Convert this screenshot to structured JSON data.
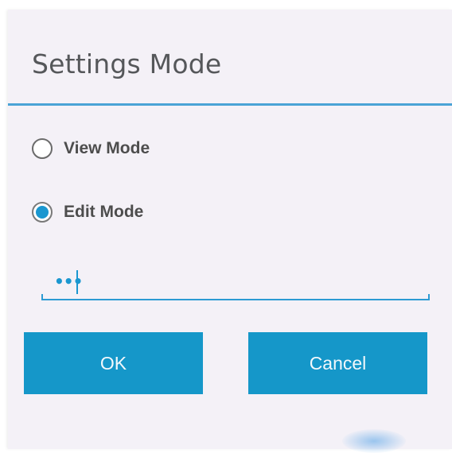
{
  "dialog": {
    "title": "Settings Mode",
    "options": [
      {
        "label": "View Mode",
        "selected": false
      },
      {
        "label": "Edit Mode",
        "selected": true
      }
    ],
    "password": {
      "value": "•••",
      "masked": true
    },
    "buttons": {
      "ok_label": "OK",
      "cancel_label": "Cancel"
    }
  },
  "colors": {
    "accent": "#1597c9",
    "divider": "#4aa3d6",
    "dialog_background": "#f4f1f7",
    "title_text": "#55575a",
    "label_text": "#4d4d4d"
  }
}
